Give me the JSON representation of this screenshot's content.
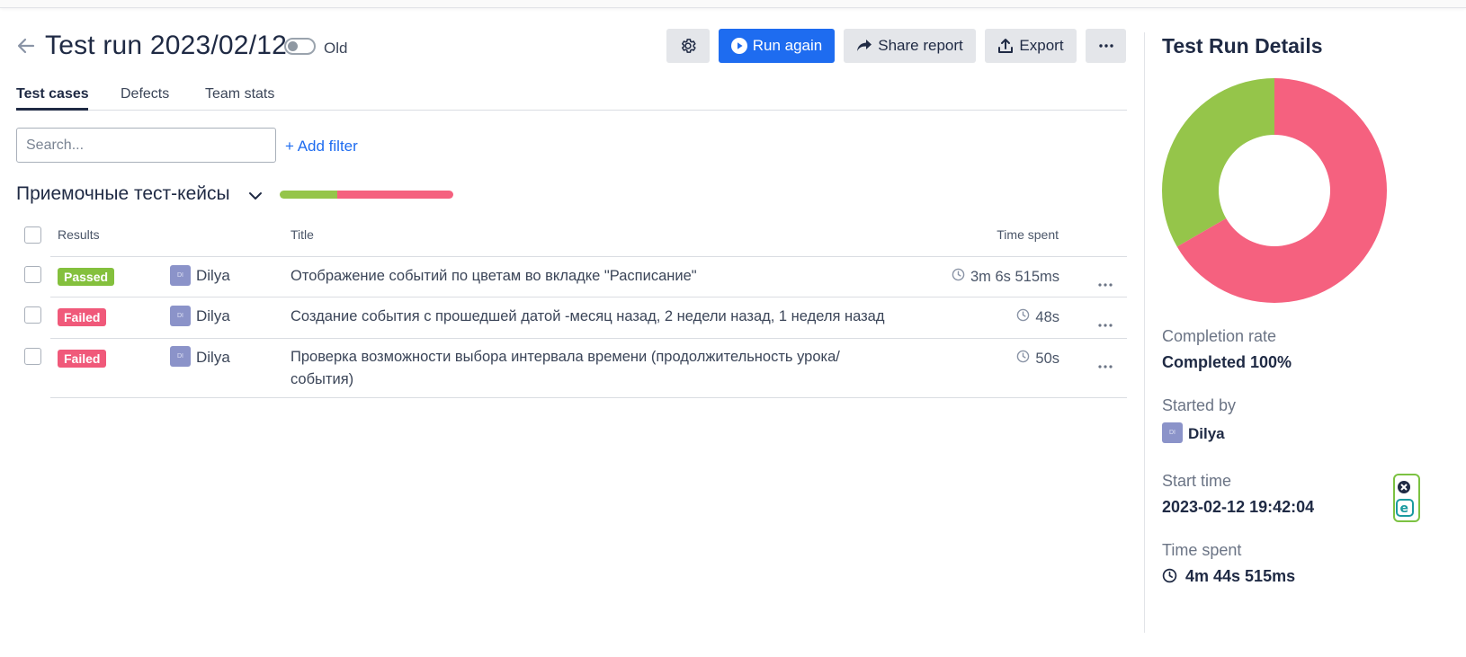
{
  "header": {
    "title": "Test run 2023/02/12",
    "toggle_label": "Old",
    "run_again_label": "Run again",
    "share_label": "Share report",
    "export_label": "Export"
  },
  "tabs": [
    {
      "label": "Test cases",
      "active": true
    },
    {
      "label": "Defects",
      "active": false
    },
    {
      "label": "Team stats",
      "active": false
    }
  ],
  "search": {
    "placeholder": "Search...",
    "value": ""
  },
  "filter": {
    "add_label": "+ Add filter"
  },
  "suite": {
    "title": "Приемочные тест-кейсы",
    "passed_fraction": 0.333,
    "failed_fraction": 0.667
  },
  "table": {
    "headers": {
      "results": "Results",
      "title": "Title",
      "time": "Time spent"
    },
    "rows": [
      {
        "status": "Passed",
        "assignee_initials": "DI",
        "assignee": "Dilya",
        "title": "Отображение событий по цветам во вкладке \"Расписание\"",
        "time": "3m 6s 515ms"
      },
      {
        "status": "Failed",
        "assignee_initials": "DI",
        "assignee": "Dilya",
        "title": "Создание события с прошедшей датой -месяц назад, 2 недели назад, 1 неделя назад",
        "time": "48s"
      },
      {
        "status": "Failed",
        "assignee_initials": "DI",
        "assignee": "Dilya",
        "title": "Проверка возможности выбора интервала времени (продолжительность урока/ события)",
        "time": "50s"
      }
    ]
  },
  "details": {
    "title": "Test Run Details",
    "chart_data": {
      "type": "pie",
      "categories": [
        "Passed",
        "Failed"
      ],
      "values": [
        1,
        2
      ],
      "colors": [
        "#95c54a",
        "#f5617f"
      ]
    },
    "completion_label": "Completion rate",
    "completion_value": "Completed 100%",
    "started_by_label": "Started by",
    "started_by_initials": "DI",
    "started_by": "Dilya",
    "start_time_label": "Start time",
    "start_time": "2023-02-12 19:42:04",
    "time_spent_label": "Time spent",
    "time_spent": "4m 44s 515ms"
  },
  "colors": {
    "primary": "#1e6cf0",
    "passed": "#84c03d",
    "failed": "#f0597a",
    "text": "#1f2a44"
  }
}
